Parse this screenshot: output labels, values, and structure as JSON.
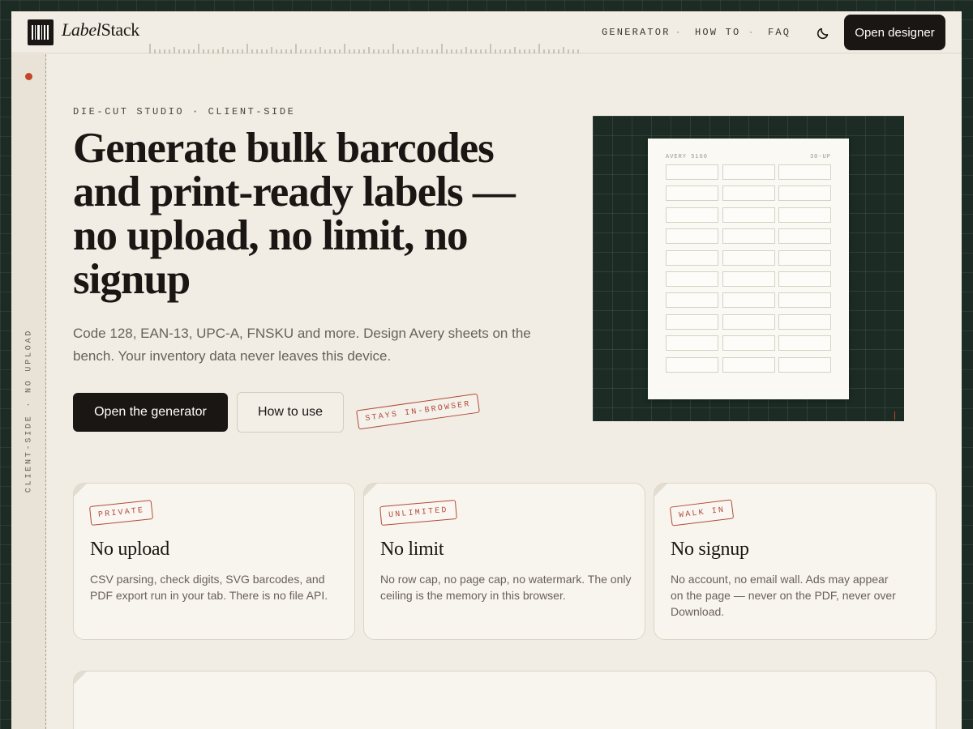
{
  "brand": {
    "name_italic": "Label",
    "name_regular": "Stack"
  },
  "nav": {
    "items": [
      "GENERATOR",
      "HOW TO",
      "FAQ"
    ],
    "separator": "·",
    "cta": "Open designer"
  },
  "rail": {
    "text": "CLIENT-SIDE · NO UPLOAD"
  },
  "hero": {
    "eyebrow": "DIE-CUT STUDIO · CLIENT-SIDE",
    "headline": "Generate bulk barcodes and print-ready labels — no upload, no limit, no signup",
    "lede": "Code 128, EAN-13, UPC-A, FNSKU and more. Design Avery sheets on the bench. Your inventory data never leaves this device.",
    "primary_button": "Open the generator",
    "secondary_button": "How to use",
    "stamp": "STAYS IN-BROWSER"
  },
  "preview": {
    "sheet_name": "AVERY 5160",
    "sheet_layout": "30-UP"
  },
  "features": [
    {
      "stamp": "PRIVATE",
      "title": "No upload",
      "body": "CSV parsing, check digits, SVG barcodes, and PDF export run in your tab. There is no file API."
    },
    {
      "stamp": "UNLIMITED",
      "title": "No limit",
      "body": "No row cap, no page cap, no watermark. The only ceiling is the memory in this browser."
    },
    {
      "stamp": "WALK IN",
      "title": "No signup",
      "body": "No account, no email wall. Ads may appear on the page — never on the PDF, never over Download."
    }
  ],
  "colors": {
    "accent": "#b24a35",
    "ink": "#1a1613",
    "paper": "#f1ede4",
    "board": "#1c2b24"
  }
}
